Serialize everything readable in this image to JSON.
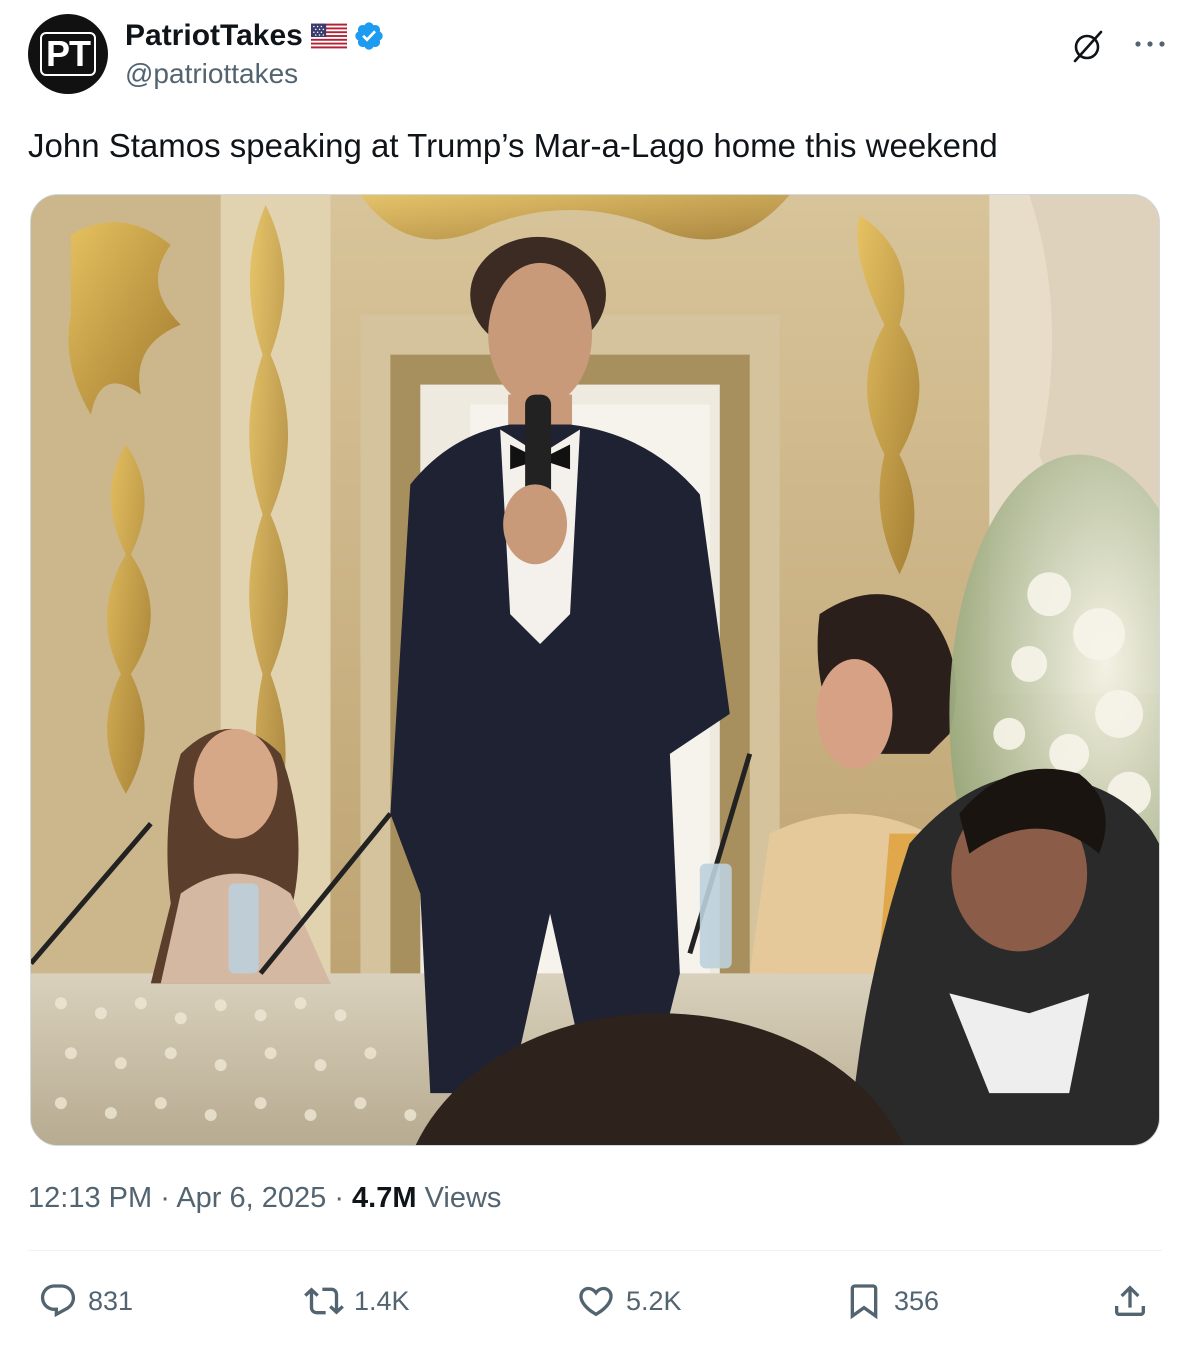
{
  "author": {
    "avatar_text": "PT",
    "display_name": "PatriotTakes",
    "handle": "@patriottakes",
    "flag_icon": "us-flag-icon",
    "verified_icon": "verified-badge-icon",
    "verified_color": "#1d9bf0"
  },
  "tweet": {
    "text": "John Stamos speaking at Trump’s Mar-a-Lago home this weekend",
    "media_description_icon": "photo"
  },
  "meta": {
    "time": "12:13 PM",
    "separator_1": " · ",
    "date": "Apr 6, 2025",
    "separator_2": " · ",
    "views_count": "4.7M",
    "views_label": " Views"
  },
  "actions": {
    "reply_count": "831",
    "retweet_count": "1.4K",
    "like_count": "5.2K",
    "bookmark_count": "356"
  },
  "icons": {
    "grok": "grok-icon",
    "more": "more-icon",
    "reply": "reply-icon",
    "retweet": "retweet-icon",
    "like": "heart-icon",
    "bookmark": "bookmark-icon",
    "share": "share-icon"
  },
  "colors": {
    "text_primary": "#0f1419",
    "text_secondary": "#536471",
    "divider": "#eff3f4"
  }
}
